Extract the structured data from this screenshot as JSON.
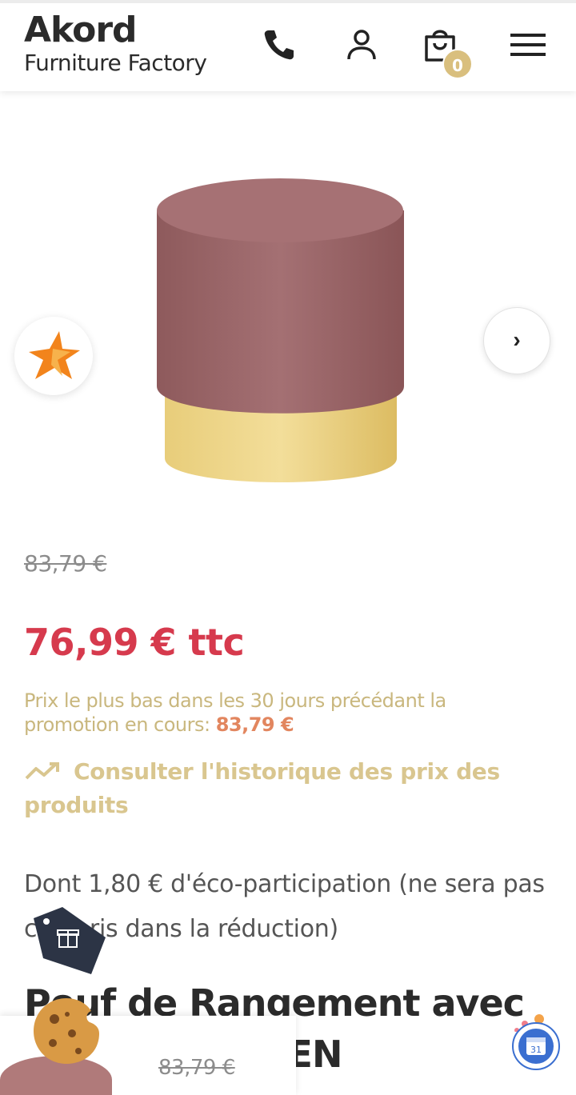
{
  "header": {
    "brand": "Akord",
    "brand_sub": "Furniture Factory",
    "cart_count": "0",
    "icons": [
      "phone-icon",
      "account-icon",
      "shopping-bag-icon",
      "menu-icon"
    ],
    "accent_color": "#d9bf7e"
  },
  "gallery": {
    "next_label": "›",
    "badge_icon": "star-logo-icon"
  },
  "product": {
    "old_price": "83,79 €",
    "price": "76,99 € ttc",
    "lowest_price_text": "Prix le plus bas dans les 30 jours précédant la promotion en cours: ",
    "lowest_price_value": "83,79 €",
    "history_link": "Consulter l'historique des prix des produits",
    "eco_text": "Dont 1,80 € d'éco-participation (ne sera pas compris dans la réduction)",
    "title": "Pouf de Rangement avec ... ORD GOLDEN"
  },
  "sticky": {
    "old_price": "83,79 €"
  },
  "colors": {
    "price_red": "#d63a4d",
    "gold": "#d9c68f",
    "lowest_highlight": "#e2865f"
  }
}
